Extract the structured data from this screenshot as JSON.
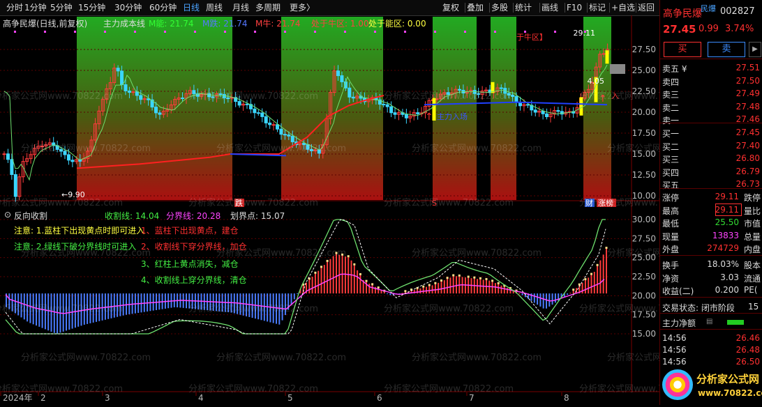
{
  "toolbar": {
    "periods": [
      "分时",
      "1分钟",
      "5分钟",
      "15分钟",
      "30分钟",
      "60分钟",
      "日线",
      "周线",
      "月线",
      "多周期",
      "更多〉"
    ],
    "active_period": "日线",
    "actions": [
      "复权",
      "叠加",
      "多股",
      "统计",
      "画线",
      "F10",
      "标记",
      "+自选",
      "返回"
    ]
  },
  "main_chart": {
    "title": "高争民爆(日线,前复权)",
    "indicator": "主力成本线",
    "m_neng_label": "M能: 21.74",
    "m_die_label": "M跌: 21.74",
    "m_niu_label": "M牛: 21.74",
    "niu_zone_label": "处于牛区: 1.00",
    "neng_zone_label": "处于能区: 0.00",
    "y_ticks": [
      "27.50",
      "25.00",
      "22.50",
      "20.00",
      "17.50",
      "15.00",
      "12.50",
      "10.00"
    ],
    "high_label": "29.11",
    "low_label": "9.90",
    "side_value": "4.05",
    "annotations": {
      "niu": "于牛区】",
      "main_in": "主力入场",
      "buy_in": "入",
      "die": "跌",
      "s": "S",
      "cai": "财",
      "zhangbang": "涨榜"
    }
  },
  "sub_chart": {
    "title": "反向收割",
    "shouge_label": "收割线: 14.04",
    "fenjie_label": "分界线: 20.28",
    "huajie_label": "划界点: 15.07",
    "notes": [
      "注意: 1.蓝柱下出现黄点时即可进入",
      "注意: 2.绿线下破分界线时可进入",
      "1、蓝柱下出现黄点，建仓",
      "2、收割线下穿分界线，加仓",
      "3、红柱上黄点消失，减仓",
      "4、收割线上穿分界线，清仓"
    ],
    "y_ticks": [
      "30.00",
      "27.50",
      "25.00",
      "22.50",
      "20.00",
      "17.50",
      "15.00"
    ]
  },
  "x_axis": {
    "labels": [
      "2024年",
      "2",
      "3",
      "4",
      "5",
      "6",
      "7",
      "8"
    ]
  },
  "watermark": "分析家公式网www.70822.com",
  "quote": {
    "name": "高争民爆",
    "badge": "民爆",
    "code": "002827",
    "price": "27.45",
    "change": "0.99",
    "change_pct": "3.74%",
    "buy_btn": "买",
    "sell_btn": "卖",
    "asks": [
      {
        "label": "卖五 ¥",
        "price": "27.51"
      },
      {
        "label": "卖四",
        "price": "27.50"
      },
      {
        "label": "卖三",
        "price": "27.49"
      },
      {
        "label": "卖二",
        "price": "27.48"
      },
      {
        "label": "卖一",
        "price": "27.46"
      }
    ],
    "bids": [
      {
        "label": "买一",
        "price": "27.45"
      },
      {
        "label": "买二",
        "price": "27.40"
      },
      {
        "label": "买三",
        "price": "26.80"
      },
      {
        "label": "买四",
        "price": "26.79"
      },
      {
        "label": "买五",
        "price": "26.73"
      }
    ],
    "stats1": [
      {
        "label": "涨停",
        "value": "29.11",
        "extra": "跌停"
      },
      {
        "label": "最高",
        "value": "29.11",
        "extra": "量比"
      },
      {
        "label": "最低",
        "value": "25.50",
        "extra": "市值"
      },
      {
        "label": "现量",
        "value": "13833",
        "extra": "总量"
      },
      {
        "label": "外盘",
        "value": "274729",
        "extra": "内盘"
      }
    ],
    "stats2": [
      {
        "label": "换手",
        "value": "18.03%",
        "extra": "股本"
      },
      {
        "label": "净资",
        "value": "3.03",
        "extra": "流通"
      },
      {
        "label": "收益(二)",
        "value": "0.200",
        "extra": "PE("
      }
    ],
    "status": "交易状态: 闭市阶段",
    "status_extra": "15",
    "net_inflow_label": "主力净额",
    "ticks": [
      {
        "time": "14:56",
        "price": "26.46"
      },
      {
        "time": "14:56",
        "price": "26.48"
      },
      {
        "time": "14:56",
        "price": "26.50"
      }
    ],
    "logo_text": "分析家公式网",
    "logo_url": "www.70822.com"
  },
  "colors": {
    "up": "#ff3b3b",
    "down": "#3ad6ff",
    "cost_line": "#ff2020",
    "ma_line": "#6ee06e",
    "yellow": "#ffff00",
    "magenta": "#ff44ff",
    "blue_line": "#2040ff"
  }
}
